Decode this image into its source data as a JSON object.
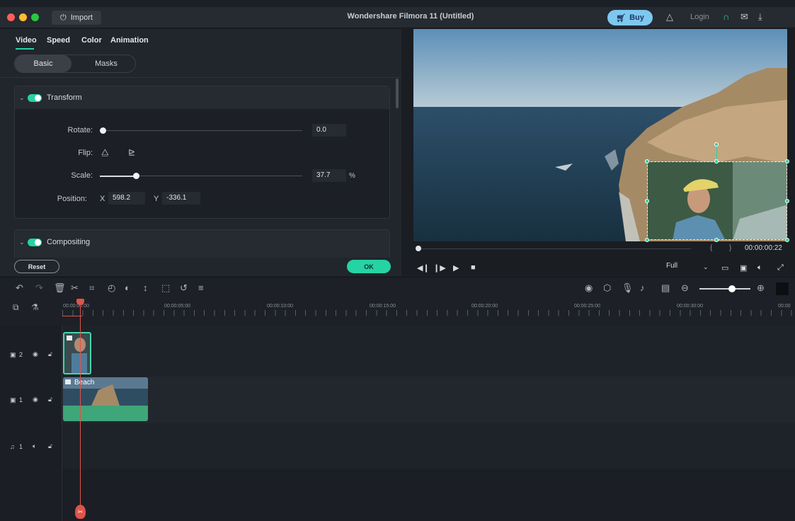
{
  "titlebar": {
    "title": "Wondershare Filmora 11 (Untitled)",
    "import_label": "Import",
    "buy_label": "Buy",
    "login_label": "Login",
    "traffic_lights": [
      "#ff5f57",
      "#febc2e",
      "#28c840"
    ]
  },
  "left_panel": {
    "tabs": [
      "Video",
      "Speed",
      "Color",
      "Animation"
    ],
    "active_tab": "Video",
    "segments": [
      "Basic",
      "Masks"
    ],
    "transform": {
      "title": "Transform",
      "rotate_label": "Rotate:",
      "rotate_value": "0.0",
      "rotate_fraction": 0.0,
      "flip_label": "Flip:",
      "scale_label": "Scale:",
      "scale_value": "37.7",
      "scale_unit": "%",
      "scale_fraction": 0.18,
      "position_label": "Position:",
      "x_label": "X",
      "x_value": "598.2",
      "y_label": "Y",
      "y_value": "-336.1"
    },
    "compositing_title": "Compositing",
    "reset_label": "Reset",
    "ok_label": "OK"
  },
  "preview": {
    "timecode": "00:00:00:22",
    "quality": "Full",
    "progress_fraction": 0.0
  },
  "ruler": {
    "labels": [
      "00:00:00:00",
      "00:00:05:00",
      "00:00:10:00",
      "00:00:15:00",
      "00:00:20:00",
      "00:00:25:00",
      "00:00:30:00",
      "00:00"
    ]
  },
  "tracks": {
    "video2_label": "2",
    "video1_label": "1",
    "audio1_label": "1",
    "clip1_name": "Beach"
  },
  "colors": {
    "accent": "#25d3a4",
    "playhead": "#e0524a",
    "buy": "#7ec8f0"
  }
}
